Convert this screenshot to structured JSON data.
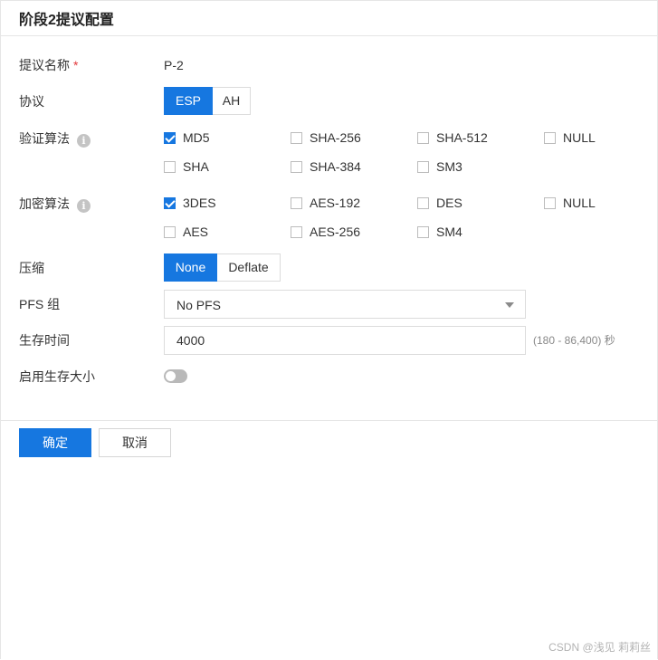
{
  "dialog": {
    "title": "阶段2提议配置"
  },
  "form": {
    "name": {
      "label": "提议名称",
      "required_mark": "*",
      "value": "P-2"
    },
    "protocol": {
      "label": "协议",
      "options": [
        "ESP",
        "AH"
      ],
      "selected": "ESP"
    },
    "auth": {
      "label": "验证算法",
      "info_icon": "info-icon",
      "options": [
        {
          "label": "MD5",
          "checked": true
        },
        {
          "label": "SHA-256",
          "checked": false
        },
        {
          "label": "SHA-512",
          "checked": false
        },
        {
          "label": "NULL",
          "checked": false
        },
        {
          "label": "SHA",
          "checked": false
        },
        {
          "label": "SHA-384",
          "checked": false
        },
        {
          "label": "SM3",
          "checked": false
        }
      ]
    },
    "encryption": {
      "label": "加密算法",
      "info_icon": "info-icon",
      "options": [
        {
          "label": "3DES",
          "checked": true
        },
        {
          "label": "AES-192",
          "checked": false
        },
        {
          "label": "DES",
          "checked": false
        },
        {
          "label": "NULL",
          "checked": false
        },
        {
          "label": "AES",
          "checked": false
        },
        {
          "label": "AES-256",
          "checked": false
        },
        {
          "label": "SM4",
          "checked": false
        }
      ]
    },
    "compression": {
      "label": "压缩",
      "options": [
        "None",
        "Deflate"
      ],
      "selected": "None"
    },
    "pfs": {
      "label": "PFS 组",
      "value": "No PFS",
      "icon": "caret-down-icon"
    },
    "lifetime": {
      "label": "生存时间",
      "value": "4000",
      "hint": "(180 - 86,400) 秒"
    },
    "lifesize": {
      "label": "启用生存大小",
      "enabled": false
    }
  },
  "footer": {
    "confirm_label": "确定",
    "cancel_label": "取消"
  },
  "watermark": "CSDN @浅见 莉莉丝",
  "colors": {
    "accent": "#1677e0",
    "required": "#e3393c",
    "border": "#dcdcdc"
  }
}
